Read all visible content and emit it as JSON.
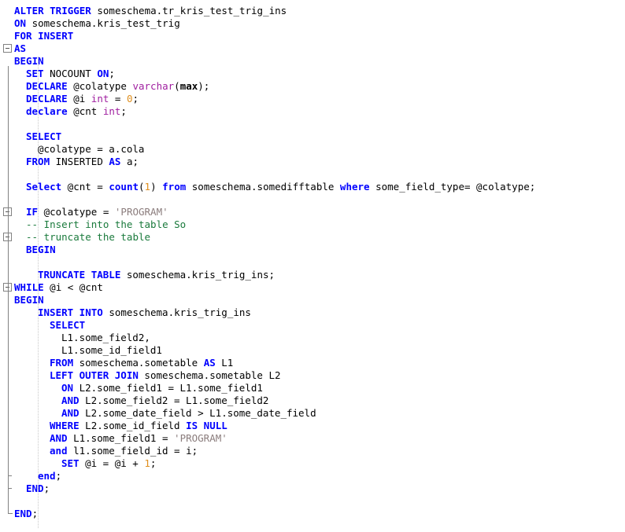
{
  "app": {
    "kind": "sql-code-editor",
    "language": "T-SQL"
  },
  "colors": {
    "background": "#ffffff",
    "keyword": "#0000ff",
    "datatype": "#a020a0",
    "string": "#8b7d7d",
    "number": "#e09020",
    "comment": "#1a7a3c",
    "plain": "#000000",
    "fold_margin": "#828282",
    "indent_guide": "#c8c8c8"
  },
  "gutter": {
    "fold_markers": [
      {
        "type": "collapse-box",
        "line": 4
      },
      {
        "type": "collapse-box",
        "line": 17
      },
      {
        "type": "collapse-box",
        "line": 19
      },
      {
        "type": "collapse-box",
        "line": 23
      },
      {
        "type": "tick",
        "line": 38
      },
      {
        "type": "tick",
        "line": 39
      },
      {
        "type": "end-corner",
        "line": 41
      }
    ]
  },
  "code": {
    "lines": [
      {
        "n": 1,
        "indent": 0,
        "tokens": [
          {
            "t": "kw",
            "v": "ALTER TRIGGER"
          },
          {
            "t": "pln",
            "v": " someschema.tr_kris_test_trig_ins"
          }
        ]
      },
      {
        "n": 2,
        "indent": 0,
        "tokens": [
          {
            "t": "kw",
            "v": "ON"
          },
          {
            "t": "pln",
            "v": " someschema.kris_test_trig"
          }
        ]
      },
      {
        "n": 3,
        "indent": 0,
        "tokens": [
          {
            "t": "kw",
            "v": "FOR INSERT"
          }
        ]
      },
      {
        "n": 4,
        "indent": 0,
        "tokens": [
          {
            "t": "kw",
            "v": "AS"
          }
        ]
      },
      {
        "n": 5,
        "indent": 0,
        "tokens": [
          {
            "t": "kw",
            "v": "BEGIN"
          }
        ]
      },
      {
        "n": 6,
        "indent": 1,
        "tokens": [
          {
            "t": "kw",
            "v": "SET"
          },
          {
            "t": "pln",
            "v": " NOCOUNT "
          },
          {
            "t": "kw",
            "v": "ON"
          },
          {
            "t": "pln",
            "v": ";"
          }
        ]
      },
      {
        "n": 7,
        "indent": 1,
        "tokens": [
          {
            "t": "kw",
            "v": "DECLARE"
          },
          {
            "t": "pln",
            "v": " @colatype "
          },
          {
            "t": "typ",
            "v": "varchar"
          },
          {
            "t": "pln",
            "v": "("
          },
          {
            "t": "bld",
            "v": "max"
          },
          {
            "t": "pln",
            "v": ");"
          }
        ]
      },
      {
        "n": 8,
        "indent": 1,
        "tokens": [
          {
            "t": "kw",
            "v": "DECLARE"
          },
          {
            "t": "pln",
            "v": " @i "
          },
          {
            "t": "typ",
            "v": "int"
          },
          {
            "t": "pln",
            "v": " = "
          },
          {
            "t": "num",
            "v": "0"
          },
          {
            "t": "pln",
            "v": ";"
          }
        ]
      },
      {
        "n": 9,
        "indent": 1,
        "tokens": [
          {
            "t": "kw",
            "v": "declare"
          },
          {
            "t": "pln",
            "v": " @cnt "
          },
          {
            "t": "typ",
            "v": "int"
          },
          {
            "t": "pln",
            "v": ";"
          }
        ]
      },
      {
        "n": 10,
        "indent": 0,
        "tokens": []
      },
      {
        "n": 11,
        "indent": 1,
        "tokens": [
          {
            "t": "kw",
            "v": "SELECT"
          }
        ]
      },
      {
        "n": 12,
        "indent": 2,
        "tokens": [
          {
            "t": "pln",
            "v": "@colatype = a.cola"
          }
        ]
      },
      {
        "n": 13,
        "indent": 1,
        "tokens": [
          {
            "t": "kw",
            "v": "FROM"
          },
          {
            "t": "pln",
            "v": " INSERTED "
          },
          {
            "t": "kw",
            "v": "AS"
          },
          {
            "t": "pln",
            "v": " a;"
          }
        ]
      },
      {
        "n": 14,
        "indent": 0,
        "tokens": []
      },
      {
        "n": 15,
        "indent": 1,
        "tokens": [
          {
            "t": "kw",
            "v": "Select"
          },
          {
            "t": "pln",
            "v": " @cnt = "
          },
          {
            "t": "fn",
            "v": "count"
          },
          {
            "t": "pln",
            "v": "("
          },
          {
            "t": "num",
            "v": "1"
          },
          {
            "t": "pln",
            "v": ") "
          },
          {
            "t": "kw",
            "v": "from"
          },
          {
            "t": "pln",
            "v": " someschema.somedifftable "
          },
          {
            "t": "kw",
            "v": "where"
          },
          {
            "t": "pln",
            "v": " some_field_type= @colatype;"
          }
        ]
      },
      {
        "n": 16,
        "indent": 0,
        "tokens": []
      },
      {
        "n": 17,
        "indent": 1,
        "tokens": [
          {
            "t": "kw",
            "v": "IF"
          },
          {
            "t": "pln",
            "v": " @colatype = "
          },
          {
            "t": "str",
            "v": "'PROGRAM'"
          }
        ]
      },
      {
        "n": 18,
        "indent": 1,
        "tokens": [
          {
            "t": "cmt",
            "v": "-- Insert into the table So"
          }
        ]
      },
      {
        "n": 19,
        "indent": 1,
        "tokens": [
          {
            "t": "cmt",
            "v": "-- truncate the table"
          }
        ]
      },
      {
        "n": 20,
        "indent": 1,
        "tokens": [
          {
            "t": "kw",
            "v": "BEGIN"
          }
        ]
      },
      {
        "n": 21,
        "indent": 0,
        "tokens": []
      },
      {
        "n": 22,
        "indent": 2,
        "tokens": [
          {
            "t": "kw",
            "v": "TRUNCATE TABLE"
          },
          {
            "t": "pln",
            "v": " someschema.kris_trig_ins;"
          }
        ]
      },
      {
        "n": 23,
        "indent": 0,
        "tokens": [
          {
            "t": "kw",
            "v": "WHILE"
          },
          {
            "t": "pln",
            "v": " @i < @cnt"
          }
        ]
      },
      {
        "n": 24,
        "indent": 0,
        "tokens": [
          {
            "t": "kw",
            "v": "BEGIN"
          }
        ]
      },
      {
        "n": 25,
        "indent": 2,
        "tokens": [
          {
            "t": "kw",
            "v": "INSERT INTO"
          },
          {
            "t": "pln",
            "v": " someschema.kris_trig_ins"
          }
        ]
      },
      {
        "n": 26,
        "indent": 3,
        "tokens": [
          {
            "t": "kw",
            "v": "SELECT"
          }
        ]
      },
      {
        "n": 27,
        "indent": 4,
        "tokens": [
          {
            "t": "pln",
            "v": "L1.some_field2,"
          }
        ]
      },
      {
        "n": 28,
        "indent": 4,
        "tokens": [
          {
            "t": "pln",
            "v": "L1.some_id_field1"
          }
        ]
      },
      {
        "n": 29,
        "indent": 3,
        "tokens": [
          {
            "t": "kw",
            "v": "FROM"
          },
          {
            "t": "pln",
            "v": " someschema.sometable "
          },
          {
            "t": "kw",
            "v": "AS"
          },
          {
            "t": "pln",
            "v": " L1"
          }
        ]
      },
      {
        "n": 30,
        "indent": 3,
        "tokens": [
          {
            "t": "kw",
            "v": "LEFT OUTER JOIN"
          },
          {
            "t": "pln",
            "v": " someschema.sometable L2"
          }
        ]
      },
      {
        "n": 31,
        "indent": 4,
        "tokens": [
          {
            "t": "kw",
            "v": "ON"
          },
          {
            "t": "pln",
            "v": " L2.some_field1 = L1.some_field1"
          }
        ]
      },
      {
        "n": 32,
        "indent": 4,
        "tokens": [
          {
            "t": "kw",
            "v": "AND"
          },
          {
            "t": "pln",
            "v": " L2.some_field2 = L1.some_field2"
          }
        ]
      },
      {
        "n": 33,
        "indent": 4,
        "tokens": [
          {
            "t": "kw",
            "v": "AND"
          },
          {
            "t": "pln",
            "v": " L2.some_date_field > L1.some_date_field"
          }
        ]
      },
      {
        "n": 34,
        "indent": 3,
        "tokens": [
          {
            "t": "kw",
            "v": "WHERE"
          },
          {
            "t": "pln",
            "v": " L2.some_id_field "
          },
          {
            "t": "kw",
            "v": "IS NULL"
          }
        ]
      },
      {
        "n": 35,
        "indent": 3,
        "tokens": [
          {
            "t": "kw",
            "v": "AND"
          },
          {
            "t": "pln",
            "v": " L1.some_field1 = "
          },
          {
            "t": "str",
            "v": "'PROGRAM'"
          }
        ]
      },
      {
        "n": 36,
        "indent": 3,
        "tokens": [
          {
            "t": "kw",
            "v": "and"
          },
          {
            "t": "pln",
            "v": " l1.some_field_id = i;"
          }
        ]
      },
      {
        "n": 37,
        "indent": 4,
        "tokens": [
          {
            "t": "kw",
            "v": "SET"
          },
          {
            "t": "pln",
            "v": " @i = @i + "
          },
          {
            "t": "num",
            "v": "1"
          },
          {
            "t": "pln",
            "v": ";"
          }
        ]
      },
      {
        "n": 38,
        "indent": 2,
        "tokens": [
          {
            "t": "kw",
            "v": "end"
          },
          {
            "t": "pln",
            "v": ";"
          }
        ]
      },
      {
        "n": 39,
        "indent": 1,
        "tokens": [
          {
            "t": "kw",
            "v": "END"
          },
          {
            "t": "pln",
            "v": ";"
          }
        ]
      },
      {
        "n": 40,
        "indent": 0,
        "tokens": []
      },
      {
        "n": 41,
        "indent": 0,
        "tokens": [
          {
            "t": "kw",
            "v": "END"
          },
          {
            "t": "pln",
            "v": ";"
          }
        ]
      }
    ]
  }
}
